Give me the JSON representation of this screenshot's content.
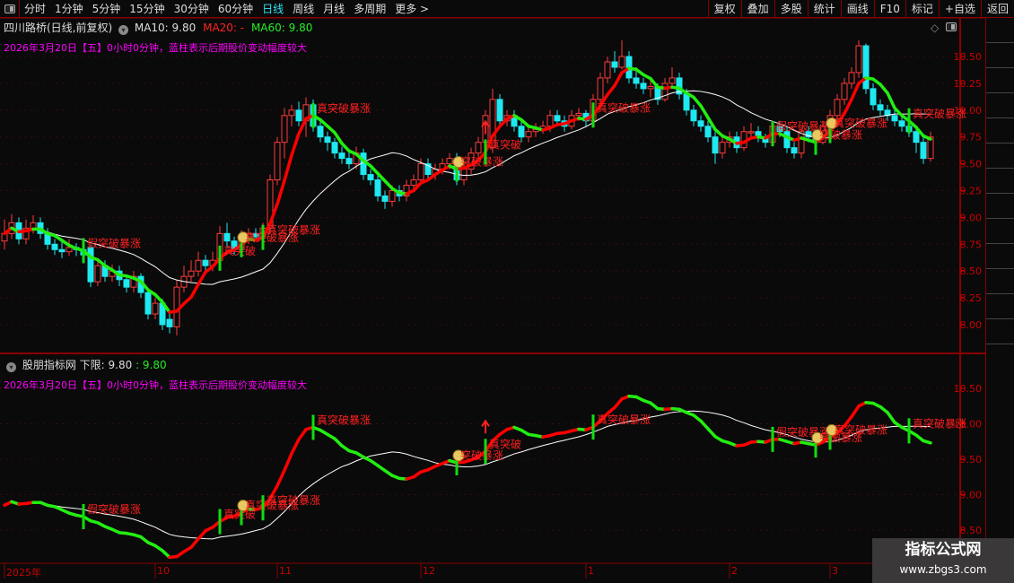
{
  "toolbar": {
    "periods": [
      "分时",
      "1分钟",
      "5分钟",
      "15分钟",
      "30分钟",
      "60分钟",
      "日线",
      "周线",
      "月线",
      "多周期",
      "更多 >"
    ],
    "active": "日线",
    "right": [
      "复权",
      "叠加",
      "多股",
      "统计",
      "画线",
      "F10",
      "标记",
      "+自选",
      "返回"
    ]
  },
  "main_panel": {
    "title": "四川路桥(日线,前复权)",
    "ma10": "MA10: 9.80",
    "ma20": "MA20: -",
    "ma60": "MA60: 9.80",
    "note": "2026年3月20日【五】0小时0分钟，蓝柱表示后期股价变动幅度较大",
    "yticks": [
      "10.50",
      "10.25",
      "10.00",
      "9.75",
      "9.50",
      "9.25",
      "9.00",
      "8.75",
      "8.50",
      "8.25",
      "8.00"
    ],
    "ylim": [
      7.8,
      10.8
    ]
  },
  "sub_panel": {
    "title": "股朋指标网",
    "lower_label": "下限: 9.80",
    "lower_value": ": 9.80",
    "note": "2026年3月20日【五】0小时0分钟，蓝柱表示后期股价变动幅度较大",
    "yticks": [
      "10.50",
      "10.00",
      "9.50",
      "9.00",
      "8.50"
    ],
    "ylim": [
      8.4,
      10.9
    ]
  },
  "xaxis": {
    "labels": [
      {
        "text": "2025年",
        "i": 0
      },
      {
        "text": "10",
        "i": 21
      },
      {
        "text": "11",
        "i": 38
      },
      {
        "text": "12",
        "i": 58
      },
      {
        "text": "1",
        "i": 81
      },
      {
        "text": "2",
        "i": 101
      },
      {
        "text": "3",
        "i": 115
      }
    ]
  },
  "colors": {
    "up": "#ff3b3b",
    "down": "#1ee8f0",
    "ma_up": "#ff0000",
    "ma_down": "#22ee11",
    "signal_bar": "#11dd11",
    "label": "#ff2020",
    "axis": "#cc0000"
  },
  "chart_data": {
    "type": "candlestick",
    "ohlc": [
      [
        8.78,
        8.98,
        8.7,
        8.85
      ],
      [
        8.85,
        9.03,
        8.8,
        8.95
      ],
      [
        8.95,
        9.0,
        8.75,
        8.8
      ],
      [
        8.8,
        8.98,
        8.75,
        8.9
      ],
      [
        8.9,
        9.02,
        8.85,
        8.95
      ],
      [
        8.95,
        9.0,
        8.8,
        8.85
      ],
      [
        8.85,
        8.9,
        8.7,
        8.75
      ],
      [
        8.75,
        8.8,
        8.65,
        8.7
      ],
      [
        8.7,
        8.78,
        8.62,
        8.68
      ],
      [
        8.68,
        8.8,
        8.64,
        8.72
      ],
      [
        8.72,
        8.76,
        8.64,
        8.7
      ],
      [
        8.7,
        8.74,
        8.6,
        8.65
      ],
      [
        8.72,
        8.75,
        8.35,
        8.4
      ],
      [
        8.4,
        8.62,
        8.36,
        8.55
      ],
      [
        8.55,
        8.6,
        8.4,
        8.45
      ],
      [
        8.45,
        8.56,
        8.4,
        8.5
      ],
      [
        8.5,
        8.55,
        8.36,
        8.42
      ],
      [
        8.42,
        8.46,
        8.3,
        8.35
      ],
      [
        8.35,
        8.5,
        8.3,
        8.45
      ],
      [
        8.45,
        8.48,
        8.25,
        8.3
      ],
      [
        8.3,
        8.34,
        8.05,
        8.1
      ],
      [
        8.1,
        8.25,
        8.05,
        8.2
      ],
      [
        8.2,
        8.24,
        7.95,
        8.0
      ],
      [
        8.05,
        8.1,
        7.92,
        7.98
      ],
      [
        7.98,
        8.42,
        7.9,
        8.35
      ],
      [
        8.35,
        8.55,
        8.3,
        8.45
      ],
      [
        8.45,
        8.6,
        8.4,
        8.5
      ],
      [
        8.5,
        8.68,
        8.45,
        8.6
      ],
      [
        8.6,
        8.65,
        8.5,
        8.55
      ],
      [
        8.55,
        8.68,
        8.5,
        8.6
      ],
      [
        8.6,
        8.92,
        8.55,
        8.85
      ],
      [
        8.85,
        8.95,
        8.72,
        8.78
      ],
      [
        8.78,
        8.82,
        8.65,
        8.7
      ],
      [
        8.7,
        8.88,
        8.66,
        8.8
      ],
      [
        8.8,
        8.9,
        8.75,
        8.85
      ],
      [
        8.85,
        8.9,
        8.78,
        8.82
      ],
      [
        8.82,
        8.95,
        8.8,
        8.9
      ],
      [
        8.9,
        9.4,
        8.85,
        9.35
      ],
      [
        9.35,
        9.75,
        9.3,
        9.7
      ],
      [
        9.7,
        10.02,
        9.55,
        9.95
      ],
      [
        9.95,
        10.05,
        9.85,
        10.0
      ],
      [
        10.0,
        10.08,
        9.85,
        9.9
      ],
      [
        9.9,
        10.12,
        9.75,
        10.05
      ],
      [
        10.05,
        10.1,
        9.8,
        9.85
      ],
      [
        9.85,
        9.9,
        9.7,
        9.75
      ],
      [
        9.75,
        9.8,
        9.62,
        9.7
      ],
      [
        9.7,
        9.74,
        9.55,
        9.6
      ],
      [
        9.6,
        9.66,
        9.5,
        9.55
      ],
      [
        9.55,
        9.62,
        9.45,
        9.5
      ],
      [
        9.5,
        9.66,
        9.45,
        9.6
      ],
      [
        9.6,
        9.64,
        9.35,
        9.4
      ],
      [
        9.4,
        9.45,
        9.3,
        9.35
      ],
      [
        9.35,
        9.4,
        9.15,
        9.2
      ],
      [
        9.2,
        9.25,
        9.08,
        9.15
      ],
      [
        9.15,
        9.3,
        9.1,
        9.25
      ],
      [
        9.25,
        9.3,
        9.15,
        9.2
      ],
      [
        9.2,
        9.35,
        9.15,
        9.3
      ],
      [
        9.3,
        9.4,
        9.25,
        9.35
      ],
      [
        9.35,
        9.55,
        9.3,
        9.5
      ],
      [
        9.5,
        9.55,
        9.35,
        9.4
      ],
      [
        9.4,
        9.5,
        9.35,
        9.45
      ],
      [
        9.45,
        9.55,
        9.4,
        9.5
      ],
      [
        9.5,
        9.6,
        9.45,
        9.55
      ],
      [
        9.55,
        9.6,
        9.3,
        9.35
      ],
      [
        9.35,
        9.5,
        9.3,
        9.45
      ],
      [
        9.45,
        9.65,
        9.4,
        9.6
      ],
      [
        9.6,
        9.75,
        9.55,
        9.7
      ],
      [
        9.7,
        10.0,
        9.65,
        9.95
      ],
      [
        9.65,
        10.2,
        9.6,
        10.1
      ],
      [
        10.1,
        10.15,
        9.85,
        9.9
      ],
      [
        9.9,
        10.0,
        9.85,
        9.95
      ],
      [
        9.95,
        10.0,
        9.8,
        9.85
      ],
      [
        9.85,
        9.9,
        9.7,
        9.75
      ],
      [
        9.75,
        9.85,
        9.7,
        9.8
      ],
      [
        9.8,
        9.88,
        9.75,
        9.82
      ],
      [
        9.82,
        9.9,
        9.78,
        9.85
      ],
      [
        9.85,
        10.0,
        9.8,
        9.95
      ],
      [
        9.95,
        10.0,
        9.85,
        9.9
      ],
      [
        9.9,
        9.95,
        9.8,
        9.85
      ],
      [
        9.85,
        10.0,
        9.82,
        9.95
      ],
      [
        9.95,
        10.02,
        9.9,
        9.97
      ],
      [
        9.97,
        10.0,
        9.85,
        9.9
      ],
      [
        9.9,
        10.15,
        9.88,
        10.1
      ],
      [
        10.1,
        10.35,
        10.05,
        10.3
      ],
      [
        10.3,
        10.5,
        10.25,
        10.45
      ],
      [
        10.45,
        10.55,
        10.35,
        10.4
      ],
      [
        10.4,
        10.65,
        10.38,
        10.5
      ],
      [
        10.5,
        10.55,
        10.25,
        10.3
      ],
      [
        10.3,
        10.4,
        10.2,
        10.25
      ],
      [
        10.25,
        10.3,
        10.15,
        10.2
      ],
      [
        10.2,
        10.28,
        10.12,
        10.22
      ],
      [
        10.22,
        10.25,
        10.05,
        10.1
      ],
      [
        10.1,
        10.3,
        10.08,
        10.25
      ],
      [
        10.25,
        10.4,
        10.2,
        10.3
      ],
      [
        10.3,
        10.35,
        10.1,
        10.15
      ],
      [
        10.15,
        10.2,
        9.95,
        10.0
      ],
      [
        10.0,
        10.05,
        9.85,
        9.9
      ],
      [
        9.9,
        9.95,
        9.8,
        9.85
      ],
      [
        9.85,
        9.9,
        9.7,
        9.75
      ],
      [
        9.75,
        9.8,
        9.5,
        9.6
      ],
      [
        9.6,
        9.75,
        9.55,
        9.7
      ],
      [
        9.7,
        9.8,
        9.65,
        9.75
      ],
      [
        9.75,
        9.8,
        9.6,
        9.65
      ],
      [
        9.65,
        9.85,
        9.62,
        9.8
      ],
      [
        9.8,
        9.88,
        9.75,
        9.8
      ],
      [
        9.8,
        9.85,
        9.7,
        9.75
      ],
      [
        9.75,
        9.78,
        9.65,
        9.7
      ],
      [
        9.7,
        9.9,
        9.68,
        9.85
      ],
      [
        9.85,
        9.9,
        9.75,
        9.8
      ],
      [
        9.8,
        9.85,
        9.6,
        9.65
      ],
      [
        9.65,
        9.7,
        9.55,
        9.6
      ],
      [
        9.6,
        9.85,
        9.55,
        9.8
      ],
      [
        9.8,
        9.85,
        9.7,
        9.75
      ],
      [
        9.75,
        9.8,
        9.65,
        9.7
      ],
      [
        9.7,
        9.9,
        9.68,
        9.85
      ],
      [
        9.85,
        10.0,
        9.8,
        9.95
      ],
      [
        9.95,
        10.15,
        9.9,
        10.1
      ],
      [
        10.1,
        10.3,
        10.05,
        10.25
      ],
      [
        10.25,
        10.4,
        10.2,
        10.35
      ],
      [
        10.35,
        10.65,
        10.3,
        10.6
      ],
      [
        10.6,
        10.62,
        10.15,
        10.2
      ],
      [
        10.2,
        10.25,
        10.0,
        10.05
      ],
      [
        10.05,
        10.1,
        9.95,
        10.0
      ],
      [
        10.0,
        10.05,
        9.9,
        9.95
      ],
      [
        9.95,
        10.0,
        9.85,
        9.9
      ],
      [
        9.9,
        9.95,
        9.8,
        9.85
      ],
      [
        9.85,
        9.9,
        9.75,
        9.8
      ],
      [
        9.8,
        9.85,
        9.6,
        9.7
      ],
      [
        9.7,
        9.75,
        9.5,
        9.55
      ],
      [
        9.55,
        9.8,
        9.52,
        9.75
      ]
    ],
    "signals": [
      {
        "i": 11,
        "text": "假突破暴涨"
      },
      {
        "i": 30,
        "text": "真突破"
      },
      {
        "i": 33,
        "text": "真突破暴涨",
        "icon": "money-bag"
      },
      {
        "i": 36,
        "text": "真突破暴涨"
      },
      {
        "i": 43,
        "text": "真突破暴涨"
      },
      {
        "i": 63,
        "text": "突破暴涨",
        "icon": "money-bag"
      },
      {
        "i": 67,
        "text": "真突破",
        "icon": "up-arrow"
      },
      {
        "i": 82,
        "text": "真突破暴涨"
      },
      {
        "i": 107,
        "text": "假突破暴涨"
      },
      {
        "i": 113,
        "text": "突破暴涨",
        "icon": "money-bag"
      },
      {
        "i": 115,
        "text": "真突破暴涨",
        "icon": "money-bag"
      },
      {
        "i": 126,
        "text": "真突破暴涨"
      }
    ]
  },
  "watermark": {
    "title": "指标公式网",
    "url": "www.zbgs3.com"
  }
}
